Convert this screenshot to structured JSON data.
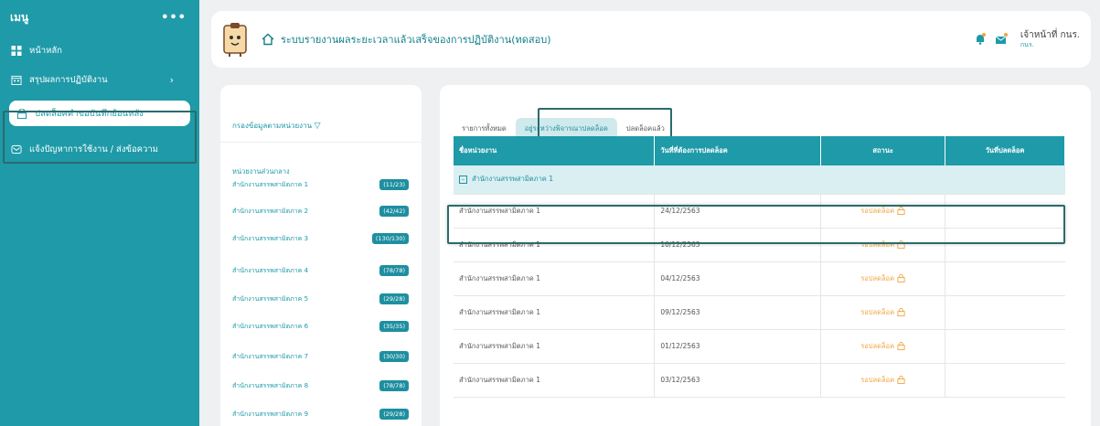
{
  "sidebar": {
    "title": "เมนู",
    "more": "•••",
    "items": [
      {
        "label": "หน้าหลัก",
        "icon": "grid-icon"
      },
      {
        "label": "สรุปผลการปฏิบัติงาน",
        "icon": "calendar-icon",
        "chevron": "›"
      },
      {
        "label": "ปลดล็อคคำขอบันทึกย้อนหลัง",
        "icon": "unlock-icon"
      },
      {
        "label": "แจ้งปัญหาการใช้งาน / ส่งข้อความ",
        "icon": "message-icon"
      }
    ]
  },
  "header": {
    "title": "ระบบรายงานผลระยะเวลาแล้วเสร็จของการปฏิบัติงาน(ทดสอบ)",
    "user_name": "เจ้าหน้าที่ กนร.",
    "user_org": "กนร."
  },
  "filter": {
    "title": "กรองข้อมูลตามหน่วยงาน",
    "dept_heading": "หน่วยงานส่วนกลาง",
    "depts": [
      {
        "name": "สำนักงานสรรพสามิตภาค 1",
        "count": "(11/23)"
      },
      {
        "name": "สำนักงานสรรพสามิตภาค 2",
        "count": "(42/42)"
      },
      {
        "name": "สำนักงานสรรพสามิตภาค 3",
        "count": "(130/130)"
      },
      {
        "name": "สำนักงานสรรพสามิตภาค 4",
        "count": "(78/78)"
      },
      {
        "name": "สำนักงานสรรพสามิตภาค 5",
        "count": "(29/28)"
      },
      {
        "name": "สำนักงานสรรพสามิตภาค 6",
        "count": "(35/35)"
      },
      {
        "name": "สำนักงานสรรพสามิตภาค 7",
        "count": "(30/30)"
      },
      {
        "name": "สำนักงานสรรพสามิตภาค 8",
        "count": "(78/78)"
      },
      {
        "name": "สำนักงานสรรพสามิตภาค 9",
        "count": "(29/28)"
      }
    ]
  },
  "tabs": [
    {
      "label": "รายการทั้งหมด"
    },
    {
      "label": "อยู่ระหว่างพิจารณาปลดล็อค"
    },
    {
      "label": "ปลดล็อคแล้ว"
    }
  ],
  "table": {
    "headers": [
      "ชื่อหน่วยงาน",
      "วันที่ที่ต้องการปลดล็อค",
      "สถานะ",
      "วันที่ปลดล็อค"
    ],
    "group": "สำนักงานสรรพสามิตภาค 1",
    "rows": [
      {
        "unit": "สำนักงานสรรพสามิตภาค 1",
        "date": "24/12/2563",
        "status": "รอปลดล็อค"
      },
      {
        "unit": "สำนักงานสรรพสามิตภาค 1",
        "date": "10/12/2563",
        "status": "รอปลดล็อค"
      },
      {
        "unit": "สำนักงานสรรพสามิตภาค 1",
        "date": "04/12/2563",
        "status": "รอปลดล็อค"
      },
      {
        "unit": "สำนักงานสรรพสามิตภาค 1",
        "date": "09/12/2563",
        "status": "รอปลดล็อค"
      },
      {
        "unit": "สำนักงานสรรพสามิตภาค 1",
        "date": "01/12/2563",
        "status": "รอปลดล็อค"
      },
      {
        "unit": "สำนักงานสรรพสามิตภาค 1",
        "date": "03/12/2563",
        "status": "รอปลดล็อค"
      }
    ]
  },
  "colors": {
    "accent": "#1e9aa8",
    "pending": "#f0a53d"
  }
}
